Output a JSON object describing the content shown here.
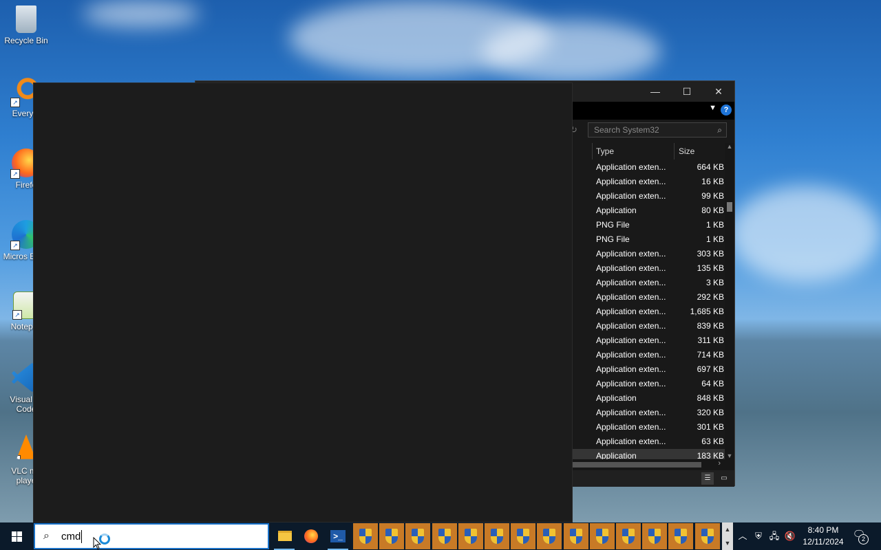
{
  "desktop": {
    "icons": [
      {
        "label": "Recycle Bin"
      },
      {
        "label": "Everyth"
      },
      {
        "label": "Firefo"
      },
      {
        "label": "Micros Edge"
      },
      {
        "label": "Notepac"
      },
      {
        "label": "Visual St Code"
      },
      {
        "label": "VLC me playe"
      }
    ]
  },
  "explorer": {
    "search_placeholder": "Search System32",
    "columns": {
      "type": "Type",
      "size": "Size"
    },
    "rows": [
      {
        "type": "Application exten...",
        "size": "664 KB"
      },
      {
        "type": "Application exten...",
        "size": "16 KB"
      },
      {
        "type": "Application exten...",
        "size": "99 KB"
      },
      {
        "type": "Application",
        "size": "80 KB"
      },
      {
        "type": "PNG File",
        "size": "1 KB"
      },
      {
        "type": "PNG File",
        "size": "1 KB"
      },
      {
        "type": "Application exten...",
        "size": "303 KB"
      },
      {
        "type": "Application exten...",
        "size": "135 KB"
      },
      {
        "type": "Application exten...",
        "size": "3 KB"
      },
      {
        "type": "Application exten...",
        "size": "292 KB"
      },
      {
        "type": "Application exten...",
        "size": "1,685 KB"
      },
      {
        "type": "Application exten...",
        "size": "839 KB"
      },
      {
        "type": "Application exten...",
        "size": "311 KB"
      },
      {
        "type": "Application exten...",
        "size": "714 KB"
      },
      {
        "type": "Application exten...",
        "size": "697 KB"
      },
      {
        "type": "Application exten...",
        "size": "64 KB"
      },
      {
        "type": "Application",
        "size": "848 KB"
      },
      {
        "type": "Application exten...",
        "size": "320 KB"
      },
      {
        "type": "Application exten...",
        "size": "301 KB"
      },
      {
        "type": "Application exten...",
        "size": "63 KB"
      },
      {
        "type": "Application",
        "size": "183 KB",
        "selected": true
      }
    ]
  },
  "taskbar": {
    "search_text": "cmd",
    "uac_count": 14,
    "clock_time": "8:40 PM",
    "clock_date": "12/11/2024",
    "notification_count": "2"
  },
  "colors": {
    "explorer_bg": "#191919",
    "taskbar_bg": "#0b1a2a",
    "accent": "#1a72c9",
    "uac_button": "#c87a26"
  }
}
